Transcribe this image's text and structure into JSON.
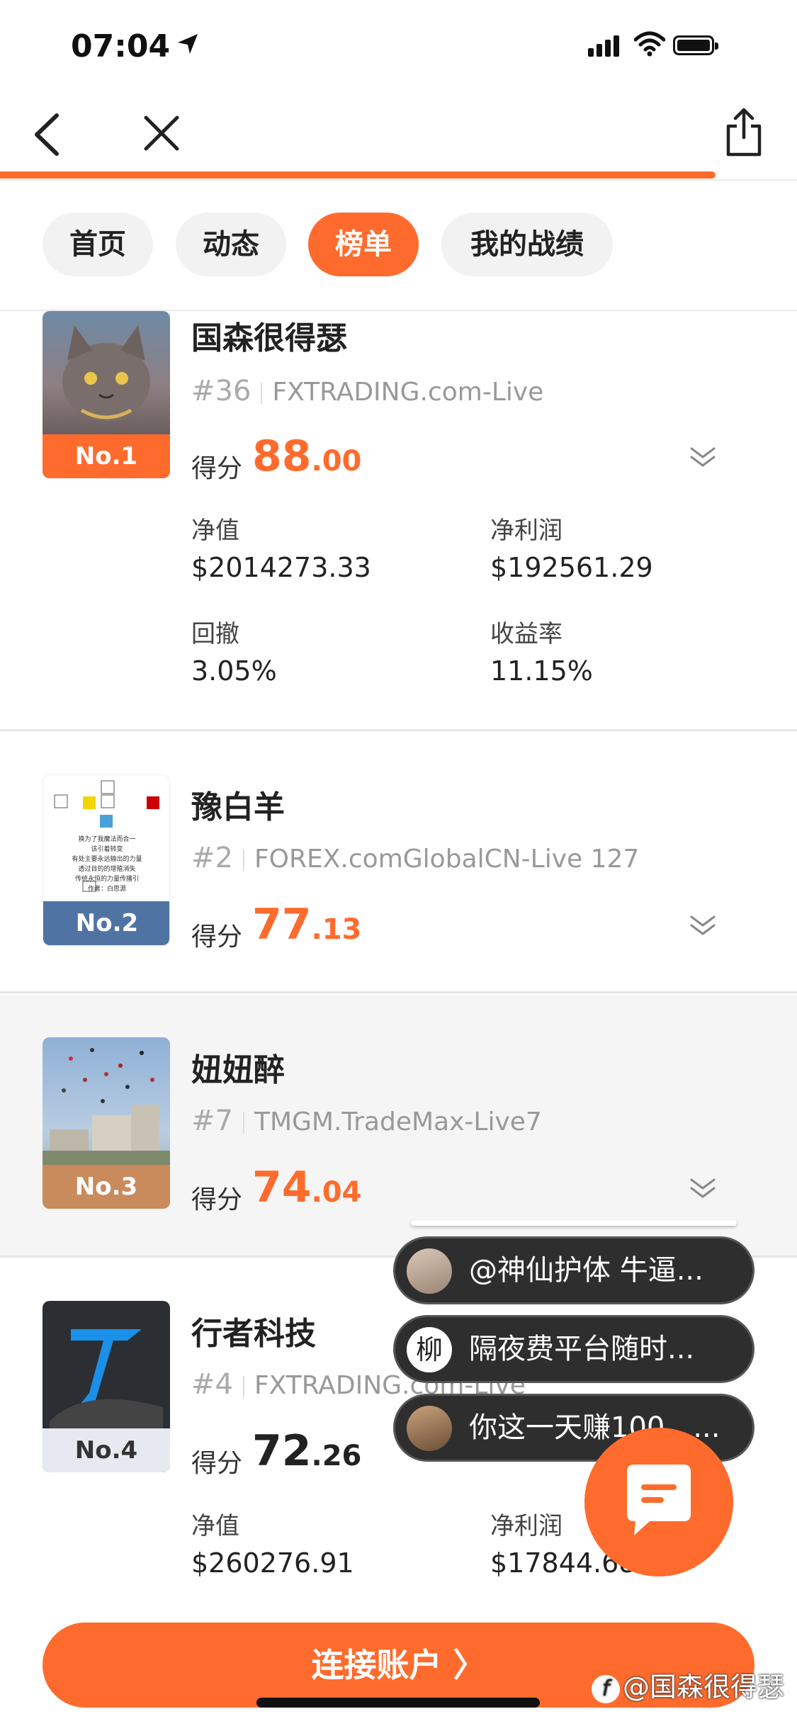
{
  "status": {
    "time": "07:04"
  },
  "tabs": [
    {
      "label": "首页",
      "active": false
    },
    {
      "label": "动态",
      "active": false
    },
    {
      "label": "榜单",
      "active": true
    },
    {
      "label": "我的战绩",
      "active": false
    }
  ],
  "entries": [
    {
      "rank": "No.1",
      "name": "国森很得瑟",
      "id": "#36",
      "server": "FXTRADING.com-Live",
      "score_label": "得分",
      "score_int": "88",
      "score_dec": ".00",
      "stats": [
        {
          "label": "净值",
          "value": "$2014273.33"
        },
        {
          "label": "净利润",
          "value": "$192561.29"
        },
        {
          "label": "回撤",
          "value": "3.05%"
        },
        {
          "label": "收益率",
          "value": "11.15%"
        }
      ]
    },
    {
      "rank": "No.2",
      "name": "豫白羊",
      "id": "#2",
      "server": "FOREX.comGlobalCN-Live 127",
      "score_label": "得分",
      "score_int": "77",
      "score_dec": ".13",
      "avatar_lines": [
        "换为了我魔法而合一",
        "该引着转变",
        "有处主要永远输出的力量",
        "透过目的的增殖消失",
        "传统永恒的力量传播引",
        "作者：白思源"
      ]
    },
    {
      "rank": "No.3",
      "name": "妞妞醉",
      "id": "#7",
      "server": "TMGM.TradeMax-Live7",
      "score_label": "得分",
      "score_int": "74",
      "score_dec": ".04"
    },
    {
      "rank": "No.4",
      "name": "行者科技",
      "id": "#4",
      "server": "FXTRADING.com-Live",
      "score_label": "得分",
      "score_int": "72",
      "score_dec": ".26",
      "stats": [
        {
          "label": "净值",
          "value": "$260276.91"
        },
        {
          "label": "净利润",
          "value": "$17844.68"
        }
      ]
    }
  ],
  "comments": [
    {
      "text": "@神仙护体 牛逼..."
    },
    {
      "text": "隔夜费平台随时...",
      "avatar_char": "柳"
    },
    {
      "text": "你这一天赚100，..."
    }
  ],
  "cta": {
    "label": "连接账户 〉"
  },
  "watermark": {
    "text": "@国森很得瑟",
    "logo": "f"
  },
  "colors": {
    "accent": "#FF6B2C",
    "rank1": "#FF6B2C",
    "rank2": "#4F74A3",
    "rank3": "#C98A5C",
    "rank4": "#E6E9EF"
  }
}
